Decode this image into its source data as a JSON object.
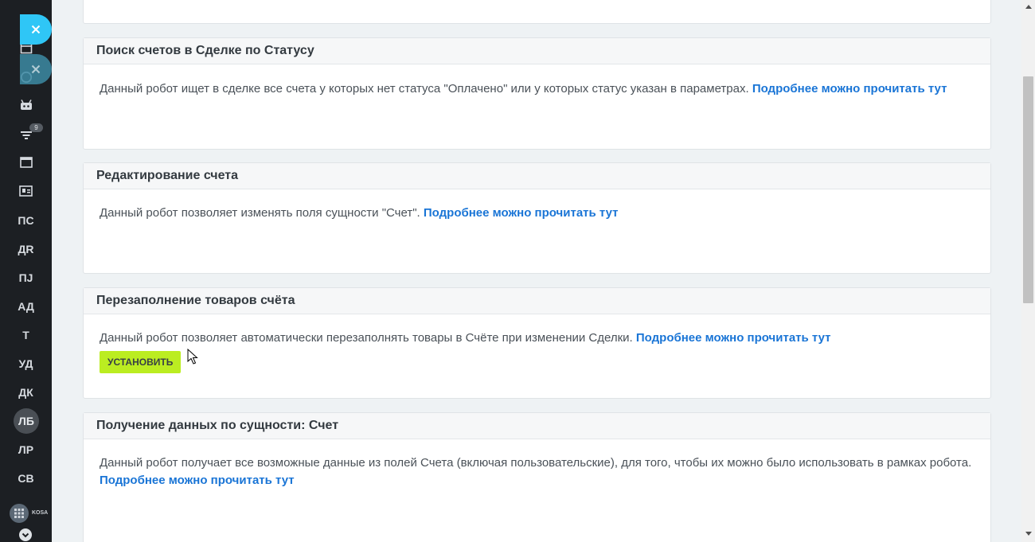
{
  "sidebar": {
    "badge_count": "9",
    "text_items": [
      "ПС",
      "ДR",
      "ПJ",
      "АД",
      "Т",
      "УД",
      "ДК"
    ],
    "active_item": "ЛБ",
    "after_items": [
      "ЛР",
      "СВ"
    ],
    "logo_text": "KOSA ВСЁ П"
  },
  "cards": [
    {
      "title": "Поиск счетов в Сделке по Статусу",
      "description": "Данный робот ищет в сделке все счета у которых нет статуса \"Оплачено\" или у которых статус указан в параметрах.",
      "link": "Подробнее можно прочитать тут"
    },
    {
      "title": "Редактирование счета",
      "description": "Данный робот позволяет изменять поля сущности \"Счет\".",
      "link": "Подробнее можно прочитать тут"
    },
    {
      "title": "Перезаполнение товаров счёта",
      "description": "Данный робот позволяет автоматически перезаполнять товары в Счёте при изменении Сделки.",
      "link": "Подробнее можно прочитать тут",
      "button": "УСТАНОВИТЬ"
    },
    {
      "title": "Получение данных по сущности: Счет",
      "description": "Данный робот получает все возможные данные из полей Счета (включая пользовательские), для того, чтобы их можно было использовать в рамках робота.",
      "link": "Подробнее можно прочитать тут"
    }
  ],
  "colors": {
    "accent_link": "#1a75d6",
    "install_button": "#bbed21",
    "close_button": "#2fc6f6",
    "sidebar_bg": "#1c1f23"
  }
}
